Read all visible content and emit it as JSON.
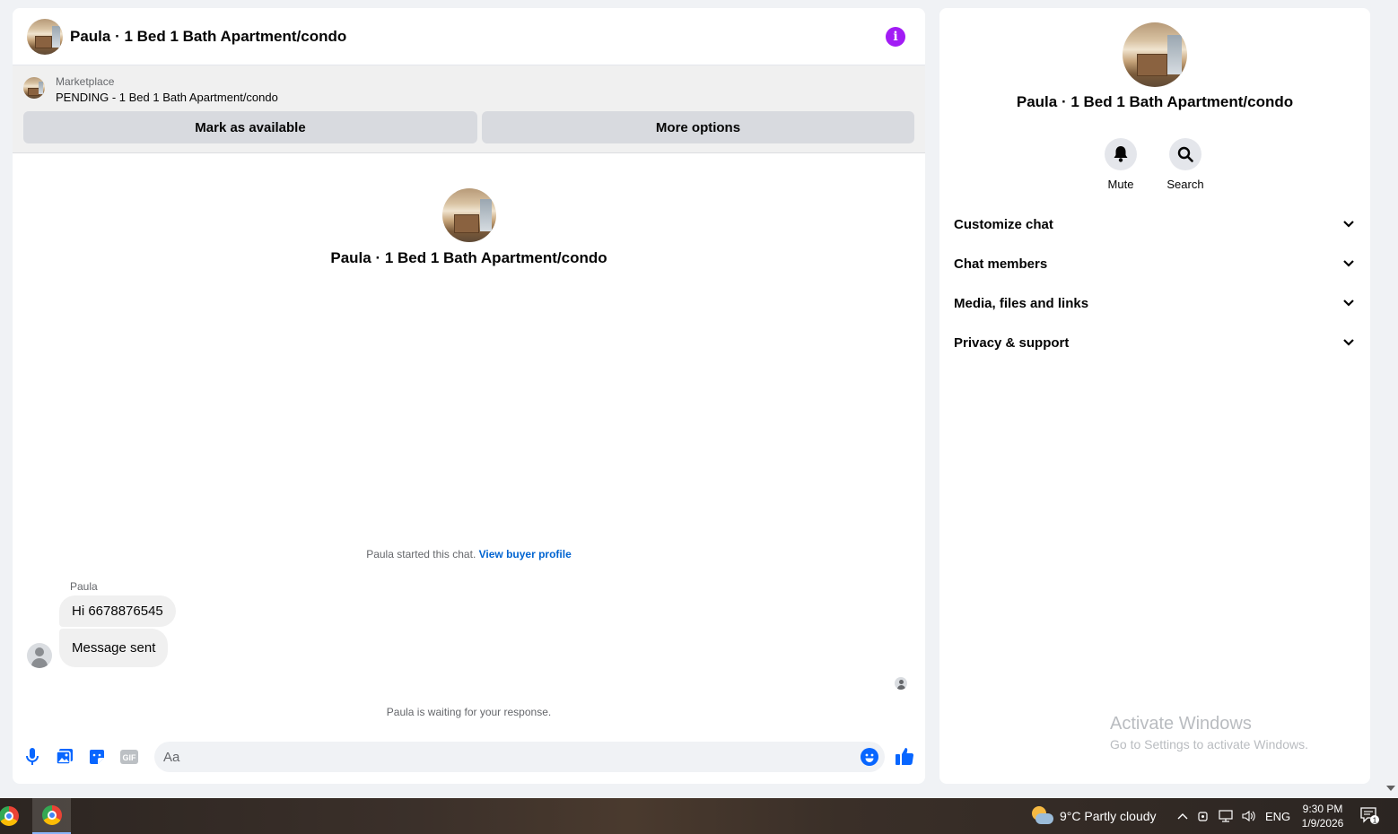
{
  "chat": {
    "title": "Paula · 1 Bed 1 Bath Apartment/condo",
    "marketplace_label": "Marketplace",
    "listing_status": "PENDING - 1 Bed 1 Bath Apartment/condo",
    "mark_available_label": "Mark as available",
    "more_options_label": "More options",
    "intro_name": "Paula · 1 Bed 1 Bath Apartment/condo",
    "started_text": "Paula started this chat.",
    "view_buyer_profile": "View buyer profile",
    "sender_name": "Paula",
    "messages": [
      "Hi 6678876545",
      "Message sent"
    ],
    "waiting_text": "Paula is waiting for your response.",
    "input_placeholder": "Aa",
    "info_glyph": "i"
  },
  "details": {
    "name": "Paula · 1 Bed 1 Bath Apartment/condo",
    "actions": [
      {
        "label": "Mute",
        "icon": "bell-icon"
      },
      {
        "label": "Search",
        "icon": "search-icon"
      }
    ],
    "sections": [
      "Customize chat",
      "Chat members",
      "Media, files and links",
      "Privacy & support"
    ]
  },
  "watermark": {
    "title": "Activate Windows",
    "subtitle": "Go to Settings to activate Windows."
  },
  "taskbar": {
    "weather": "9°C  Partly cloudy",
    "language": "ENG",
    "time": "9:30 PM",
    "date": "1/9/2026",
    "notification_count": "1"
  },
  "colors": {
    "accent": "#0866ff",
    "info": "#a21cf5",
    "link": "#0064d1"
  }
}
